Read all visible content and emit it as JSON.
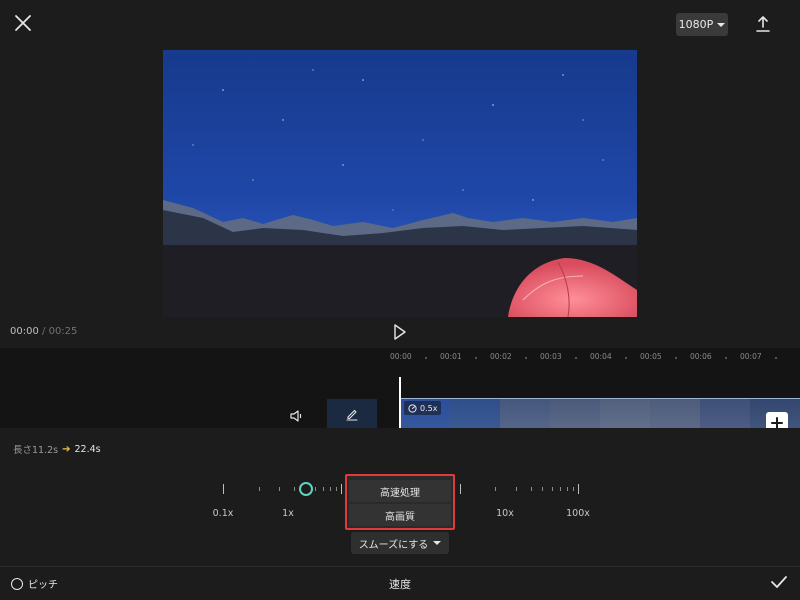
{
  "topbar": {
    "close_icon": "close-icon",
    "resolution_label": "1080P",
    "export_icon": "upload-icon"
  },
  "player": {
    "current_time": "00:00",
    "separator": "/",
    "total_time": "00:25",
    "play_icon": "play-icon"
  },
  "timeline": {
    "ruler": [
      "00:00",
      "00:01",
      "00:02",
      "00:03",
      "00:04",
      "00:05",
      "00:06",
      "00:07"
    ],
    "clip_speed_label": "0.5x",
    "mute_icon": "speaker-icon",
    "edit_icon": "pencil-icon",
    "add_icon": "plus-icon"
  },
  "speed_panel": {
    "length_prefix": "長さ11.2s",
    "length_new": "22.4s",
    "speed_labels": [
      "0.1x",
      "1x",
      "10x",
      "100x"
    ],
    "speed_value": 0.5,
    "popup_options": [
      "高速処理",
      "高画質"
    ],
    "smooth_label": "スムーズにする",
    "pitch_label": "ピッチ",
    "title": "速度",
    "confirm_icon": "check-icon"
  },
  "colors": {
    "accent": "#5fd3c3",
    "highlight_border": "#e03a3a",
    "arrow": "#f0c23c"
  }
}
